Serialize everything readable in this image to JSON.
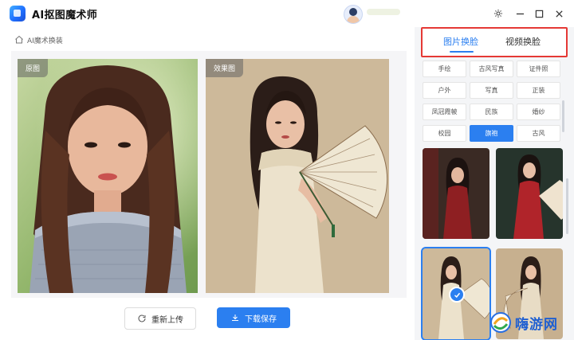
{
  "app": {
    "title": "AI抠图魔术师"
  },
  "breadcrumb": {
    "label": "AI魔术换装"
  },
  "images": {
    "original_label": "原图",
    "result_label": "效果图"
  },
  "actions": {
    "reupload_label": "重新上传",
    "save_label": "下载保存"
  },
  "tabs": [
    {
      "label": "图片换脸",
      "active": true
    },
    {
      "label": "视频换脸",
      "active": false
    }
  ],
  "tags": [
    {
      "label": "手绘",
      "active": false
    },
    {
      "label": "古风写真",
      "active": false
    },
    {
      "label": "证件照",
      "active": false
    },
    {
      "label": "户外",
      "active": false
    },
    {
      "label": "写真",
      "active": false
    },
    {
      "label": "正装",
      "active": false
    },
    {
      "label": "凤冠霞帔",
      "active": false
    },
    {
      "label": "民族",
      "active": false
    },
    {
      "label": "婚纱",
      "active": false
    },
    {
      "label": "校园",
      "active": false
    },
    {
      "label": "旗袍",
      "active": true
    },
    {
      "label": "古风",
      "active": false
    }
  ],
  "watermark": {
    "text": "嗨游网"
  },
  "colors": {
    "accent": "#2b7ff0",
    "highlight_border": "#e53935",
    "panel_bg": "#f4f5f7"
  },
  "icons": {
    "home": "home-icon",
    "refresh": "refresh-icon",
    "download": "download-icon",
    "settings": "settings-icon",
    "minimize": "minimize-icon",
    "maximize": "maximize-icon",
    "close": "close-icon",
    "check": "check-icon"
  }
}
